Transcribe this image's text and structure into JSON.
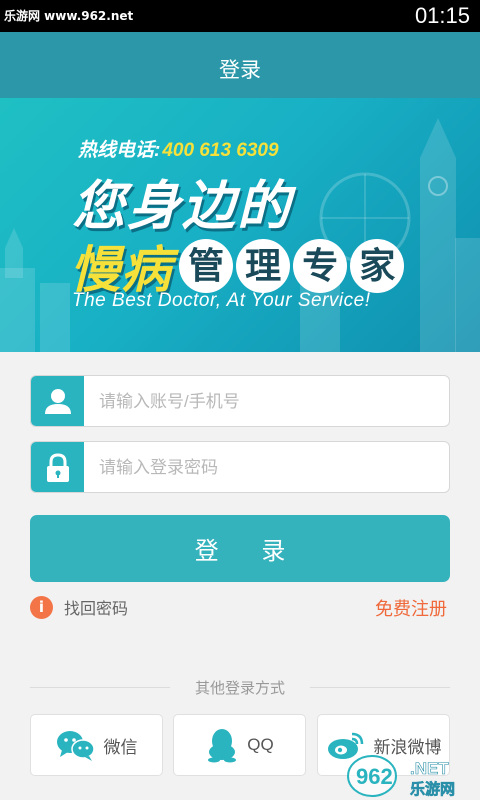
{
  "status_bar": {
    "watermark": "乐游网 www.962.net",
    "time": "01:15"
  },
  "header": {
    "title": "登录"
  },
  "banner": {
    "hotline_label": "热线电话:",
    "hotline_number": "400 613 6309",
    "headline_1": "您身边的",
    "headline_2_highlight": "慢病",
    "headline_2_circles": [
      "管",
      "理",
      "专",
      "家"
    ],
    "slogan": "The Best Doctor, At Your Service!"
  },
  "form": {
    "account_placeholder": "请输入账号/手机号",
    "password_placeholder": "请输入登录密码",
    "login_label": "登 录",
    "forgot_label": "找回密码",
    "register_label": "免费注册"
  },
  "other_login": {
    "title": "其他登录方式",
    "options": [
      {
        "label": "微信",
        "icon": "wechat-icon"
      },
      {
        "label": "QQ",
        "icon": "qq-icon"
      },
      {
        "label": "新浪微博",
        "icon": "weibo-icon"
      }
    ]
  },
  "watermark": {
    "text": "962",
    "suffix": ".NET",
    "sub": "乐游网"
  },
  "colors": {
    "primary": "#2b97a8",
    "button": "#35b3bd",
    "accent": "#f0693a"
  }
}
